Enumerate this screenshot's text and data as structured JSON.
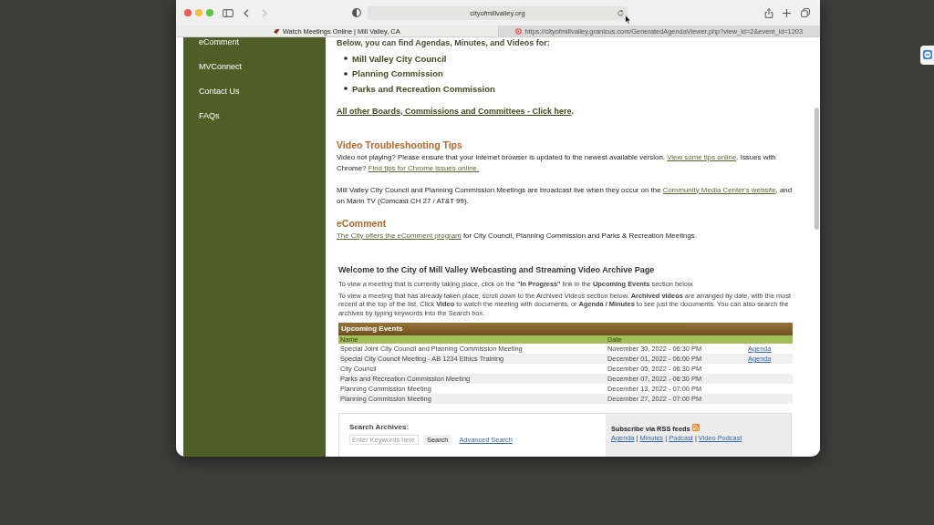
{
  "browser": {
    "navigation": {
      "back": {
        "disabled": false
      },
      "forward": {
        "disabled": true
      }
    },
    "address": "cityofmillvalley.org",
    "tabs": [
      {
        "title": "Watch Meetings Online | Mill Valley, CA",
        "selected": true
      },
      {
        "title": "https://cityofmillvalley.granicus.com/GeneratedAgendaViewer.php?view_id=2&event_id=1203",
        "selected": false
      }
    ]
  },
  "sidebar": {
    "items": [
      "eComment",
      "MVConnect",
      "Contact Us",
      "FAQs"
    ]
  },
  "intro": {
    "text": "Below, you can find Agendas, Minutes, and Videos for:",
    "bodies": [
      "Mill Valley City Council",
      "Planning Commission",
      "Parks and Recreation Commission"
    ],
    "more": [
      {
        "kind": "link",
        "text": "All other Boards, Commissions and Committees - Click here"
      },
      {
        "kind": "text",
        "text": "."
      }
    ]
  },
  "sections": [
    {
      "heading": "Video Troubleshooting Tips",
      "paragraphs": [
        [
          {
            "kind": "text",
            "text": "Video not playing? Please ensure that your internet browser is updated to the newest available version. "
          },
          {
            "kind": "link",
            "text": "View some tips online"
          },
          {
            "kind": "text",
            "text": ". Issues with Chrome? "
          },
          {
            "kind": "link",
            "text": "Find tips for Chrome issues online."
          }
        ],
        [
          {
            "kind": "text",
            "text": "Mill Valley City Council and Planning Commission Meetings are broadcast live when they occur on the "
          },
          {
            "kind": "link",
            "text": "Community Media Center's website"
          },
          {
            "kind": "text",
            "text": ", and on Marin TV (Comcast CH 27 / AT&T 99)."
          }
        ]
      ]
    },
    {
      "heading": "eComment",
      "paragraphs": [
        [
          {
            "kind": "link",
            "text": "The City offers the eComment program"
          },
          {
            "kind": "text",
            "text": " for City Council, Planning Commission and Parks & Recreation Meetings."
          }
        ]
      ]
    }
  ],
  "archive": {
    "title": "Welcome to the City of Mill Valley Webcasting and Streaming Video Archive Page",
    "notes": [
      "To view a meeting that is currently taking place, click on the **\"In Progress\"** link in the **Upcoming Events** section below.",
      "To view a meeting that has already taken place, scroll down to the Archived Videos section below. **Archived videos** are arranged by date, with the most recent at the top of the list. Click **Video** to watch the meeting with documents, or **Agenda / Minutes** to see just the documents. You can also search the archives by typing keywords into the Search box."
    ]
  },
  "upcoming_events": {
    "title": "Upcoming Events",
    "columns": [
      "Name",
      "Date"
    ],
    "rows": [
      {
        "name": "Special Joint City Council and Planning Commission Meeting",
        "date": "November 30, 2022 - 06:30 PM",
        "agenda": "Agenda"
      },
      {
        "name": "Special City Council Meeting - AB 1234 Ethics Training",
        "date": "December 01, 2022 - 06:00 PM",
        "agenda": "Agenda"
      },
      {
        "name": "City Council",
        "date": "December 05, 2022 - 06:30 PM"
      },
      {
        "name": "Parks and Recreation Commission Meeting",
        "date": "December 07, 2022 - 06:30 PM"
      },
      {
        "name": "Planning Commission Meeting",
        "date": "December 13, 2022 - 07:00 PM"
      },
      {
        "name": "Planning Commission Meeting",
        "date": "December 27, 2022 - 07:00 PM"
      }
    ]
  },
  "search": {
    "label": "Search Archives:",
    "placeholder": "Enter Keywords here",
    "button": "Search",
    "advanced_link": "Advanced Search"
  },
  "rss": {
    "title": "Subscribe via RSS feeds",
    "links": [
      "Agenda",
      "Minutes",
      "Podcast",
      "Video Podcast"
    ],
    "separator": "|"
  }
}
